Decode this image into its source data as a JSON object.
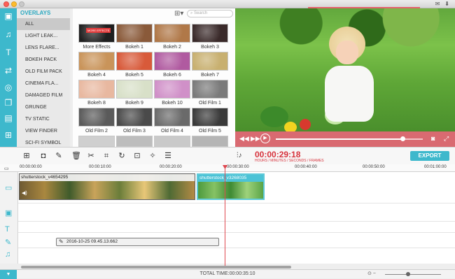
{
  "overlays": {
    "title": "OVERLAYS",
    "categories": [
      {
        "label": "ALL",
        "selected": true
      },
      {
        "label": "LIGHT LEAK..."
      },
      {
        "label": "LENS FLARE..."
      },
      {
        "label": "BOKEH PACK"
      },
      {
        "label": "OLD FILM PACK"
      },
      {
        "label": "CINEMA FLA..."
      },
      {
        "label": "DAMAGED FILM"
      },
      {
        "label": "GRUNGE"
      },
      {
        "label": "TV STATIC"
      },
      {
        "label": "VIEW FINDER"
      },
      {
        "label": "SCI-FI SYMBOL"
      }
    ]
  },
  "grid": {
    "search_placeholder": "Search",
    "items": [
      {
        "label": "More Effects",
        "color": "#1f1f1f",
        "badge": "MORE EFFECTS"
      },
      {
        "label": "Bokeh 1",
        "color": "#8a5a3a"
      },
      {
        "label": "Bokeh 2",
        "color": "#b07848"
      },
      {
        "label": "Bokeh 3",
        "color": "#3a2a2a"
      },
      {
        "label": "Bokeh 4",
        "color": "#c9945a"
      },
      {
        "label": "Bokeh 5",
        "color": "#d85a3a"
      },
      {
        "label": "Bokeh 6",
        "color": "#b05aa0"
      },
      {
        "label": "Bokeh 7",
        "color": "#c8b070"
      },
      {
        "label": "Bokeh 8",
        "color": "#e8b8a0"
      },
      {
        "label": "Bokeh 9",
        "color": "#d8e0c8"
      },
      {
        "label": "Bokeh 10",
        "color": "#d090c8"
      },
      {
        "label": "Old Film 1",
        "color": "#7a7a7a"
      },
      {
        "label": "Old Film 2",
        "color": "#5a5a5a"
      },
      {
        "label": "Old Film 3",
        "color": "#4a4a4a"
      },
      {
        "label": "Old Film 4",
        "color": "#6a6a6a"
      },
      {
        "label": "Old Film 5",
        "color": "#3a3a3a"
      }
    ],
    "partial_row_colors": [
      "#cfcfcf",
      "#bdbdbd",
      "#c9c9c9",
      "#b5b5b5"
    ]
  },
  "preview": {
    "progress": 0.86
  },
  "toolbar": {
    "timecode": "00:00:29:18",
    "timecode_hint": "HOURS / MINUTES / SECONDS / FRAMES",
    "export_label": "EXPORT"
  },
  "ruler": {
    "ticks": [
      "00:00:00:00",
      "00:00:10:00",
      "00:00:20:00",
      "00:00:30:00",
      "00:00:40:00",
      "00:00:50:00",
      "00:01:00:00"
    ]
  },
  "timeline": {
    "clips": [
      {
        "name": "shutterstock_v4654295"
      },
      {
        "name": "shutterstock_v3268035"
      }
    ],
    "voiceover": "2016-10-25 09.45.13.662"
  },
  "status": {
    "total_time": "TOTAL TIME:00:00:35:10"
  },
  "colors": {
    "accent": "#3db8cc",
    "timecode": "#d7323c",
    "playhead": "#e0474f"
  }
}
